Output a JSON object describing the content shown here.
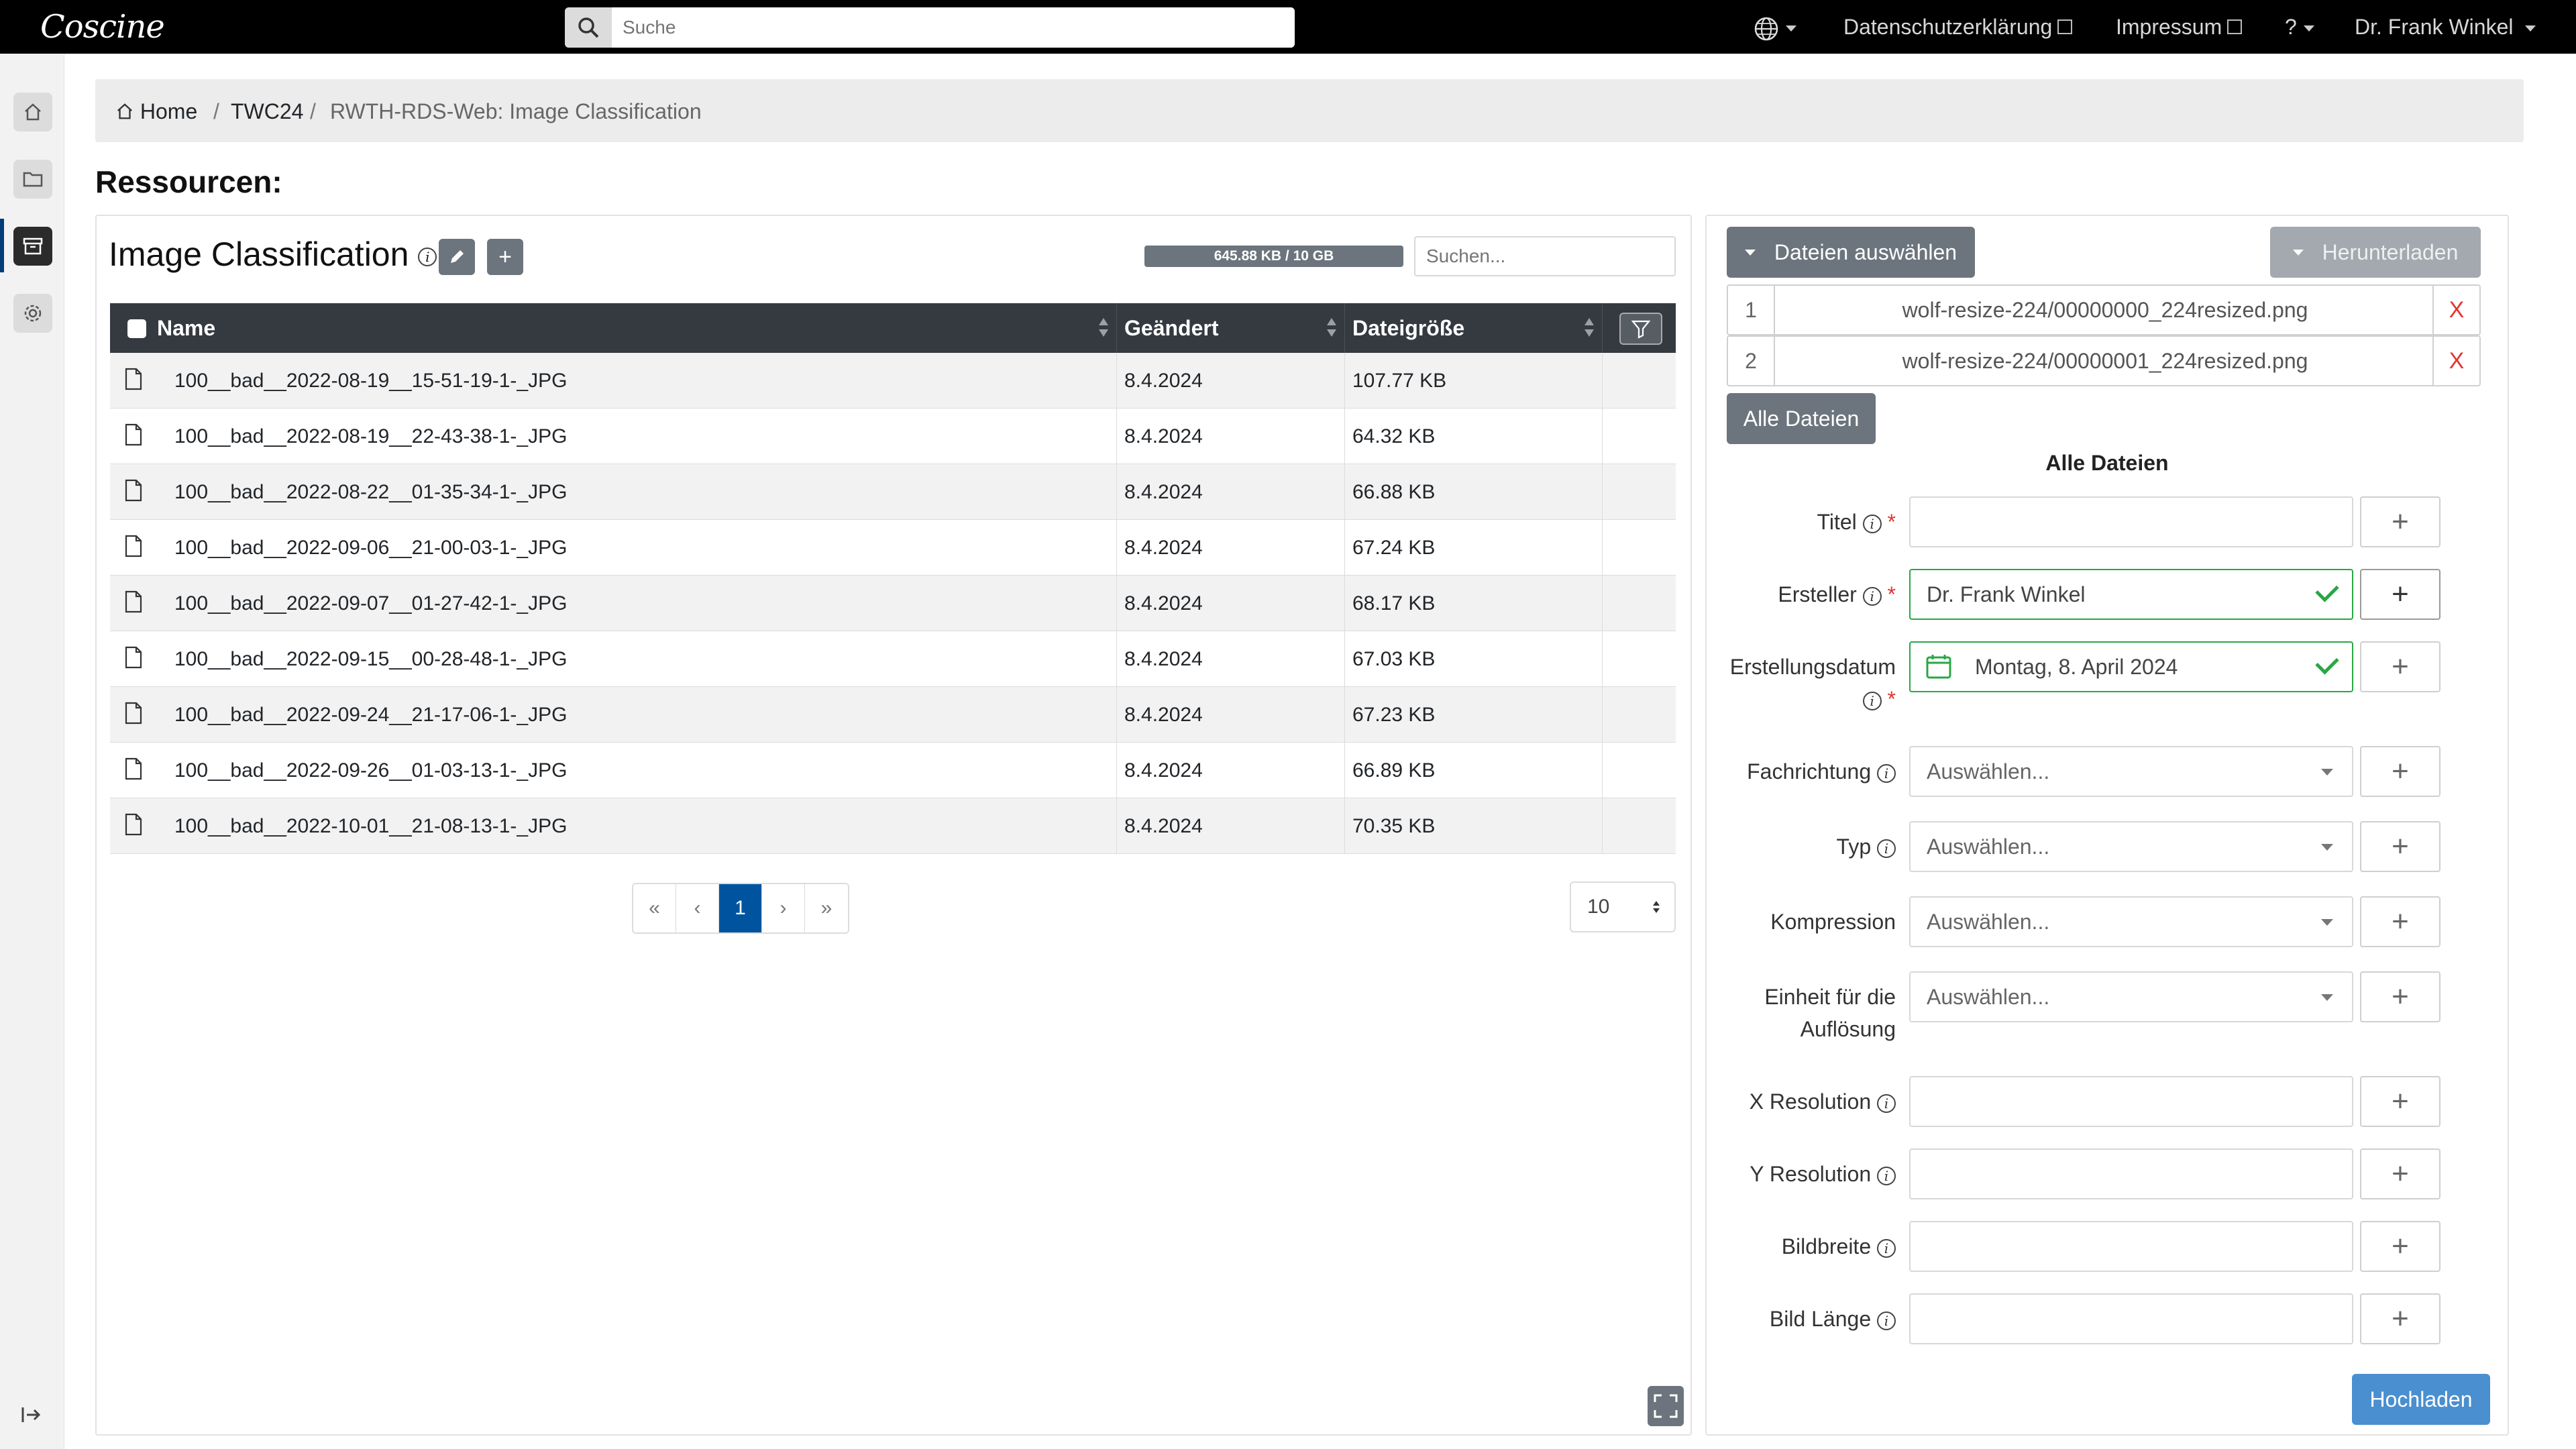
{
  "app": {
    "logo": "Coscine"
  },
  "topbar": {
    "search_placeholder": "Suche",
    "privacy_label": "Datenschutzerklärung",
    "imprint_label": "Impressum",
    "help_label": "?",
    "user_name": "Dr. Frank Winkel"
  },
  "sidebar": {
    "items": [
      {
        "icon": "home-icon"
      },
      {
        "icon": "folder-icon"
      },
      {
        "icon": "archive-icon",
        "active": true
      },
      {
        "icon": "gear-icon"
      }
    ],
    "collapse_icon": "expand-sidebar-icon"
  },
  "breadcrumb": {
    "home": "Home",
    "sep1": "/",
    "project": "TWC24",
    "sep2": "/",
    "current": "RWTH-RDS-Web: Image Classification"
  },
  "page": {
    "heading": "Ressourcen:"
  },
  "resource": {
    "title": "Image Classification",
    "quota": "645.88 KB / 10 GB",
    "search_placeholder": "Suchen..."
  },
  "table": {
    "columns": {
      "name": "Name",
      "modified": "Geändert",
      "size": "Dateigröße"
    },
    "rows": [
      {
        "name": "100__bad__2022-08-19__15-51-19-1-_JPG",
        "modified": "8.4.2024",
        "size": "107.77 KB"
      },
      {
        "name": "100__bad__2022-08-19__22-43-38-1-_JPG",
        "modified": "8.4.2024",
        "size": "64.32 KB"
      },
      {
        "name": "100__bad__2022-08-22__01-35-34-1-_JPG",
        "modified": "8.4.2024",
        "size": "66.88 KB"
      },
      {
        "name": "100__bad__2022-09-06__21-00-03-1-_JPG",
        "modified": "8.4.2024",
        "size": "67.24 KB"
      },
      {
        "name": "100__bad__2022-09-07__01-27-42-1-_JPG",
        "modified": "8.4.2024",
        "size": "68.17 KB"
      },
      {
        "name": "100__bad__2022-09-15__00-28-48-1-_JPG",
        "modified": "8.4.2024",
        "size": "67.03 KB"
      },
      {
        "name": "100__bad__2022-09-24__21-17-06-1-_JPG",
        "modified": "8.4.2024",
        "size": "67.23 KB"
      },
      {
        "name": "100__bad__2022-09-26__01-03-13-1-_JPG",
        "modified": "8.4.2024",
        "size": "66.89 KB"
      },
      {
        "name": "100__bad__2022-10-01__21-08-13-1-_JPG",
        "modified": "8.4.2024",
        "size": "70.35 KB"
      }
    ]
  },
  "pagination": {
    "first": "«",
    "prev": "‹",
    "current": "1",
    "next": "›",
    "last": "»",
    "page_size": "10"
  },
  "upload": {
    "select_files_label": "Dateien auswählen",
    "download_label": "Herunterladen",
    "files": [
      {
        "num": "1",
        "path": "wolf-resize-224/00000000_224resized.png",
        "remove": "X"
      },
      {
        "num": "2",
        "path": "wolf-resize-224/00000001_224resized.png",
        "remove": "X"
      }
    ],
    "all_files_button": "Alle Dateien",
    "form_heading": "Alle Dateien",
    "upload_label": "Hochladen",
    "required_mark": "*",
    "fields": {
      "titel": {
        "label": "Titel",
        "value": ""
      },
      "ersteller": {
        "label": "Ersteller",
        "value": "Dr. Frank Winkel"
      },
      "erstellungsdatum": {
        "label": "Erstellungsdatum",
        "value": "Montag, 8. April 2024"
      },
      "fachrichtung": {
        "label": "Fachrichtung",
        "value": "Auswählen..."
      },
      "typ": {
        "label": "Typ",
        "value": "Auswählen..."
      },
      "kompression": {
        "label": "Kompression",
        "value": "Auswählen..."
      },
      "einheit_line1": {
        "label": "Einheit für die"
      },
      "einheit_line2": {
        "label": "Auflösung",
        "value": "Auswählen..."
      },
      "x_resolution": {
        "label": "X Resolution",
        "value": ""
      },
      "y_resolution": {
        "label": "Y Resolution",
        "value": ""
      },
      "bildbreite": {
        "label": "Bildbreite",
        "value": ""
      },
      "bild_laenge": {
        "label": "Bild Länge",
        "value": ""
      }
    }
  },
  "colors": {
    "accent": "#00549f",
    "valid": "#28a745",
    "danger": "#e3342f",
    "button": "#6c757d",
    "upload": "#4a8fd0"
  }
}
